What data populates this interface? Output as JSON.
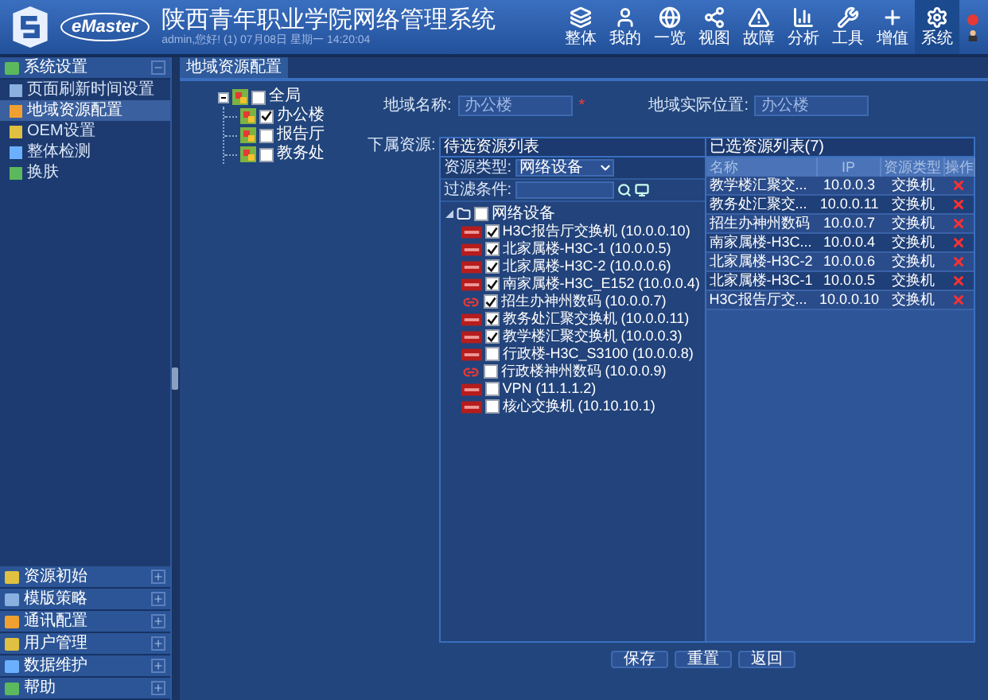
{
  "header": {
    "brand": "eMaster",
    "title": "陕西青年职业学院网络管理系统",
    "subtitle": "admin,您好! (1) 07月08日 星期一 14:20:04",
    "nav": [
      {
        "label": "整体",
        "selected": false
      },
      {
        "label": "我的",
        "selected": false
      },
      {
        "label": "一览",
        "selected": false
      },
      {
        "label": "视图",
        "selected": false
      },
      {
        "label": "故障",
        "selected": false
      },
      {
        "label": "分析",
        "selected": false
      },
      {
        "label": "工具",
        "selected": false
      },
      {
        "label": "增值",
        "selected": false
      },
      {
        "label": "系统",
        "selected": true
      }
    ]
  },
  "sidebar": {
    "groups": [
      {
        "title": "系统设置",
        "expanded": true,
        "items": [
          {
            "label": "页面刷新时间设置",
            "selected": false
          },
          {
            "label": "地域资源配置",
            "selected": true
          },
          {
            "label": "OEM设置",
            "selected": false
          },
          {
            "label": "整体检测",
            "selected": false
          },
          {
            "label": "换肤",
            "selected": false
          }
        ]
      },
      {
        "title": "资源初始",
        "expanded": false
      },
      {
        "title": "模版策略",
        "expanded": false
      },
      {
        "title": "通讯配置",
        "expanded": false
      },
      {
        "title": "用户管理",
        "expanded": false
      },
      {
        "title": "数据维护",
        "expanded": false
      },
      {
        "title": "帮助",
        "expanded": false
      }
    ]
  },
  "tab": {
    "label": "地域资源配置"
  },
  "region_tree": {
    "label": "全局",
    "checked": false,
    "expanded": true,
    "children": [
      {
        "label": "办公楼",
        "checked": true
      },
      {
        "label": "报告厅",
        "checked": false
      },
      {
        "label": "教务处",
        "checked": false
      }
    ]
  },
  "form": {
    "name_label": "地域名称:",
    "name_value": "办公楼",
    "required_mark": "*",
    "location_label": "地域实际位置:",
    "location_value": "办公楼",
    "resources_label": "下属资源:"
  },
  "candidates": {
    "title": "待选资源列表",
    "type_label": "资源类型:",
    "type_value": "网络设备",
    "filter_label": "过滤条件:",
    "root": {
      "label": "网络设备",
      "checked": false,
      "expanded": true,
      "children": [
        {
          "label": "H3C报告厅交换机 (10.0.0.10)",
          "kind": "switch",
          "checked": true
        },
        {
          "label": "北家属楼-H3C-1 (10.0.0.5)",
          "kind": "switch",
          "checked": true
        },
        {
          "label": "北家属楼-H3C-2 (10.0.0.6)",
          "kind": "switch",
          "checked": true
        },
        {
          "label": "南家属楼-H3C_E152 (10.0.0.4)",
          "kind": "switch",
          "checked": true
        },
        {
          "label": "招生办神州数码 (10.0.0.7)",
          "kind": "link",
          "checked": true
        },
        {
          "label": "教务处汇聚交换机 (10.0.0.11)",
          "kind": "switch",
          "checked": true
        },
        {
          "label": "教学楼汇聚交换机 (10.0.0.3)",
          "kind": "switch",
          "checked": true
        },
        {
          "label": "行政楼-H3C_S3100 (10.0.0.8)",
          "kind": "switch",
          "checked": false
        },
        {
          "label": "行政楼神州数码 (10.0.0.9)",
          "kind": "link",
          "checked": false
        },
        {
          "label": "VPN (11.1.1.2)",
          "kind": "switch",
          "checked": false
        },
        {
          "label": "核心交换机 (10.10.10.1)",
          "kind": "switch",
          "checked": false
        }
      ]
    }
  },
  "selected": {
    "title": "已选资源列表(7)",
    "columns": [
      "名称",
      "IP",
      "资源类型",
      "操作"
    ],
    "rows": [
      {
        "name": "教学楼汇聚交...",
        "ip": "10.0.0.3",
        "type": "交换机"
      },
      {
        "name": "教务处汇聚交...",
        "ip": "10.0.0.11",
        "type": "交换机"
      },
      {
        "name": "招生办神州数码",
        "ip": "10.0.0.7",
        "type": "交换机"
      },
      {
        "name": "南家属楼-H3C...",
        "ip": "10.0.0.4",
        "type": "交换机"
      },
      {
        "name": "北家属楼-H3C-2",
        "ip": "10.0.0.6",
        "type": "交换机"
      },
      {
        "name": "北家属楼-H3C-1",
        "ip": "10.0.0.5",
        "type": "交换机"
      },
      {
        "name": "H3C报告厅交...",
        "ip": "10.0.0.10",
        "type": "交换机"
      }
    ]
  },
  "buttons": [
    "保存",
    "重置",
    "返回"
  ]
}
